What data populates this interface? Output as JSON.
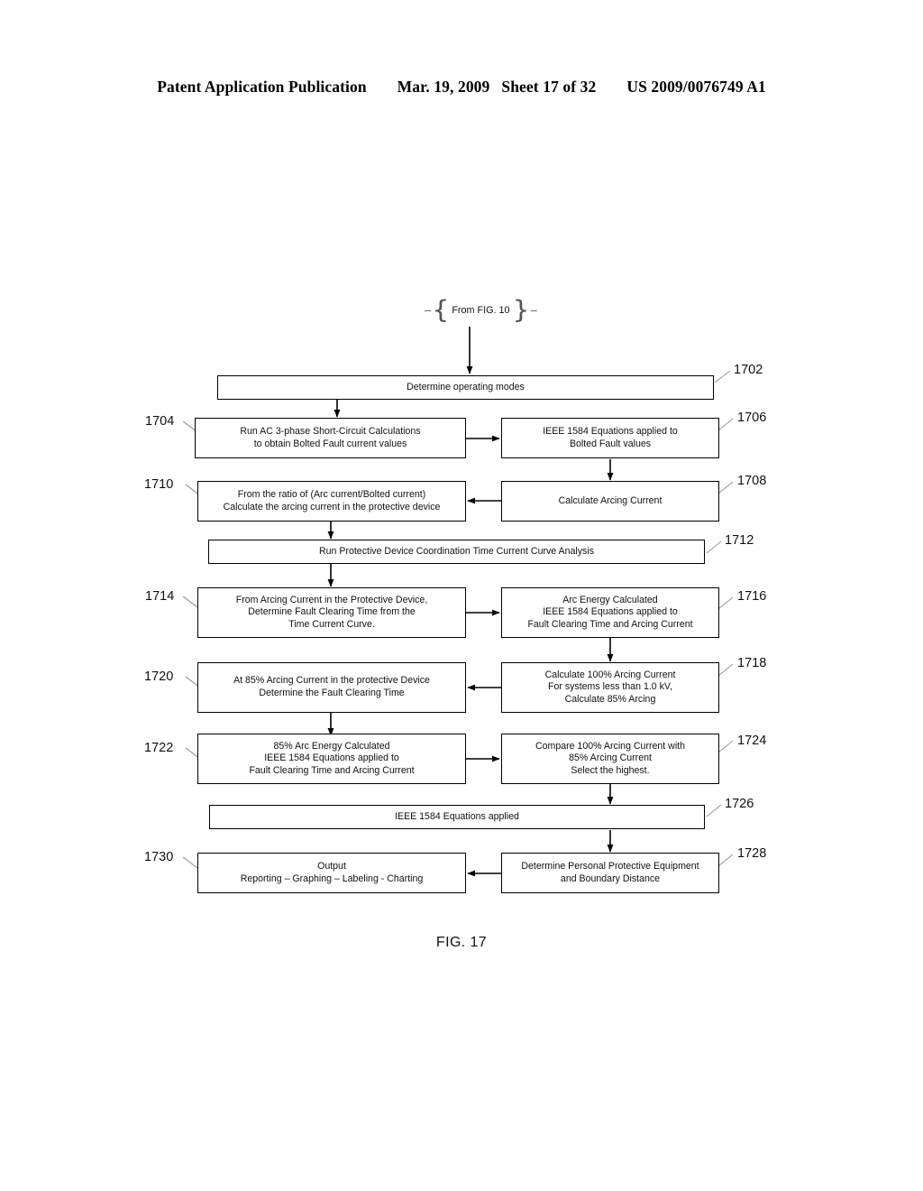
{
  "header": {
    "publication": "Patent Application Publication",
    "date": "Mar. 19, 2009",
    "sheet": "Sheet 17 of 32",
    "number": "US 2009/0076749 A1"
  },
  "figure": {
    "caption": "FIG. 17",
    "entry_connector": "From FIG. 10"
  },
  "nodes": [
    {
      "ref": "1702",
      "lines": [
        "Determine operating modes"
      ]
    },
    {
      "ref": "1704",
      "lines": [
        "Run AC 3-phase Short-Circuit Calculations",
        "to obtain Bolted Fault current values"
      ]
    },
    {
      "ref": "1706",
      "lines": [
        "IEEE 1584 Equations applied to",
        "Bolted Fault values"
      ]
    },
    {
      "ref": "1708",
      "lines": [
        "Calculate Arcing Current"
      ]
    },
    {
      "ref": "1710",
      "lines": [
        "From the ratio of (Arc current/Bolted current)",
        "Calculate the arcing current in the protective device"
      ]
    },
    {
      "ref": "1712",
      "lines": [
        "Run Protective Device Coordination Time Current Curve Analysis"
      ]
    },
    {
      "ref": "1714",
      "lines": [
        "From Arcing Current in the Protective Device,",
        "Determine Fault Clearing Time from the",
        "Time Current Curve."
      ]
    },
    {
      "ref": "1716",
      "lines": [
        "Arc Energy Calculated",
        "IEEE 1584 Equations applied to",
        "Fault Clearing Time and Arcing Current"
      ]
    },
    {
      "ref": "1718",
      "lines": [
        "Calculate 100% Arcing Current",
        "For systems less than 1.0 kV,",
        "Calculate 85% Arcing"
      ]
    },
    {
      "ref": "1720",
      "lines": [
        "At 85% Arcing Current in the protective Device",
        "Determine the Fault Clearing Time"
      ]
    },
    {
      "ref": "1722",
      "lines": [
        "85% Arc Energy Calculated",
        "IEEE 1584 Equations applied to",
        "Fault Clearing Time and Arcing Current"
      ]
    },
    {
      "ref": "1724",
      "lines": [
        "Compare 100% Arcing Current with",
        "85% Arcing Current",
        "Select the highest."
      ]
    },
    {
      "ref": "1726",
      "lines": [
        "IEEE 1584 Equations applied"
      ]
    },
    {
      "ref": "1728",
      "lines": [
        "Determine Personal Protective Equipment",
        "and Boundary Distance"
      ]
    },
    {
      "ref": "1730",
      "lines": [
        "Output",
        "Reporting – Graphing – Labeling - Charting"
      ]
    }
  ],
  "colors": {
    "ink": "#000000",
    "paper": "#ffffff",
    "leader": "#9a9a9a"
  }
}
